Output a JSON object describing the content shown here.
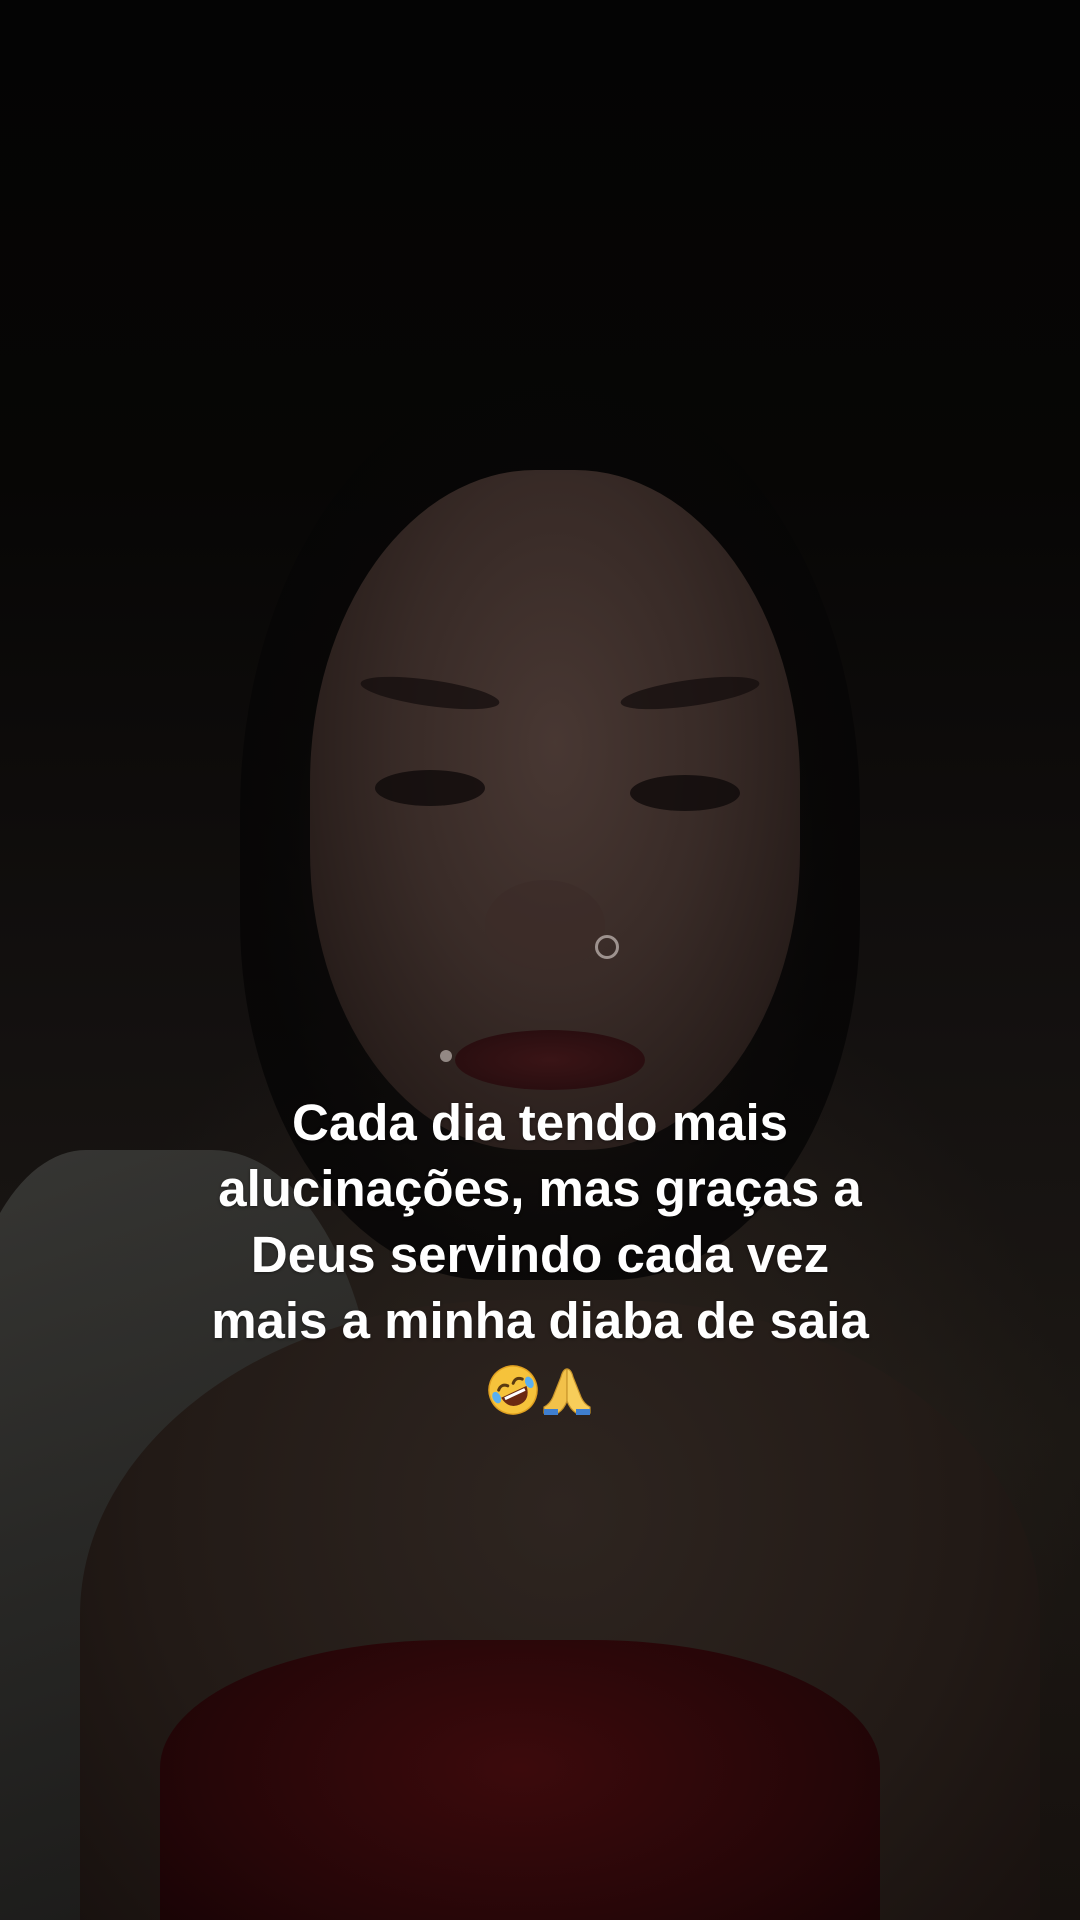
{
  "caption": {
    "lines": [
      "Cada dia tendo mais",
      "alucinações, mas graças a",
      "Deus servindo cada vez",
      "mais a minha diaba de saia"
    ],
    "emojis": [
      {
        "char": "🤣",
        "icon": "rolling-on-floor-laughing-icon"
      },
      {
        "char": "🙏",
        "icon": "folded-hands-icon"
      }
    ]
  },
  "colors": {
    "caption_text": "#ffffff",
    "background": "#050403",
    "top_accent": "#3c0a0c"
  }
}
